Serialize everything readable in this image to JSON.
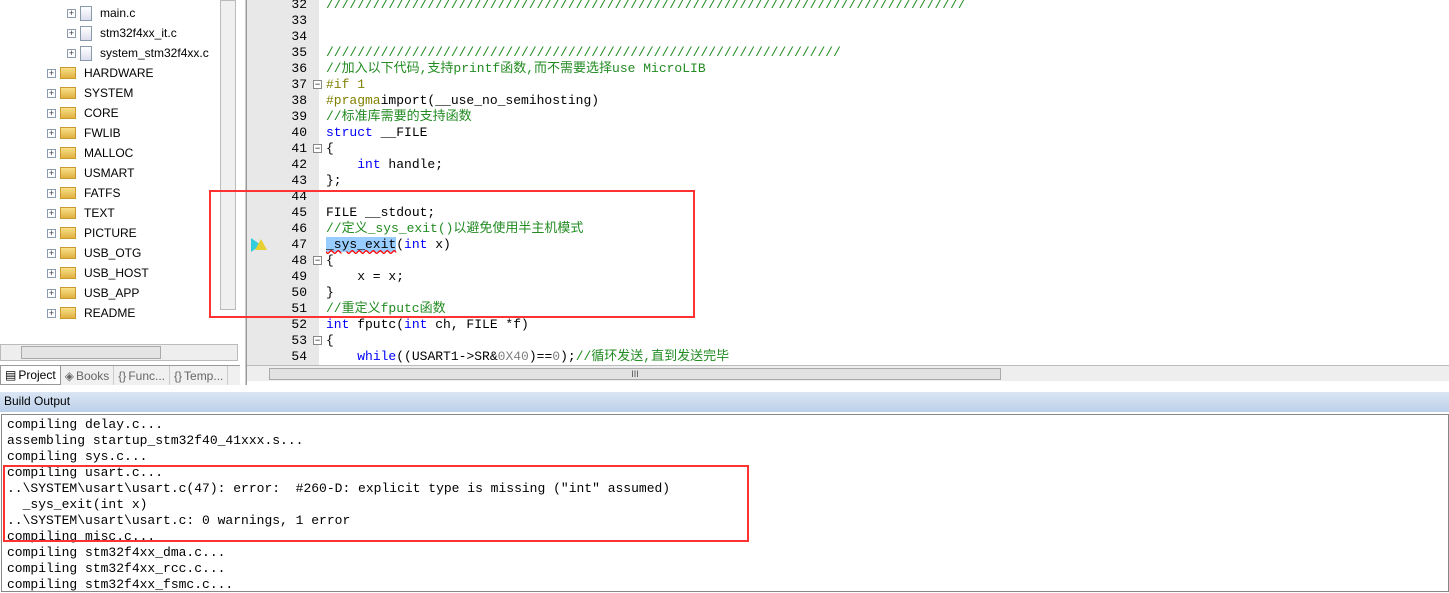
{
  "project_tree": {
    "files": [
      "main.c",
      "stm32f4xx_it.c",
      "system_stm32f4xx.c"
    ],
    "folders": [
      "HARDWARE",
      "SYSTEM",
      "CORE",
      "FWLIB",
      "MALLOC",
      "USMART",
      "FATFS",
      "TEXT",
      "PICTURE",
      "USB_OTG",
      "USB_HOST",
      "USB_APP",
      "README"
    ]
  },
  "panel_tabs": [
    {
      "label": "Project",
      "active": true
    },
    {
      "label": "Books"
    },
    {
      "label": "Func..."
    },
    {
      "label": "Temp..."
    }
  ],
  "editor": {
    "first_line": 32,
    "lines": [
      [
        [
          "c",
          "//////////////////////////////////////////////////////////////////////////////////"
        ]
      ],
      [],
      [],
      [
        [
          "c",
          "//////////////////////////////////////////////////////////////////"
        ]
      ],
      [
        [
          "c",
          "//加入以下代码,支持printf函数,而不需要选择use MicroLIB"
        ]
      ],
      [
        [
          "p",
          "#if 1"
        ]
      ],
      [
        [
          "p",
          "#pragma"
        ],
        [
          "",
          "import(__use_no_semihosting)"
        ]
      ],
      [
        [
          "c",
          "//标准库需要的支持函数"
        ]
      ],
      [
        [
          "k",
          "struct"
        ],
        [
          "",
          " __FILE"
        ]
      ],
      [
        [
          "",
          "{"
        ]
      ],
      [
        [
          "",
          "    "
        ],
        [
          "k",
          "int"
        ],
        [
          "",
          " handle;"
        ]
      ],
      [
        [
          "",
          "};"
        ]
      ],
      [],
      [
        [
          "",
          "FILE __stdout;"
        ]
      ],
      [
        [
          "c",
          "//定义_sys_exit()以避免使用半主机模式"
        ]
      ],
      [
        [
          "hl",
          "_sys_exit"
        ],
        [
          "",
          "("
        ],
        [
          "k",
          "int"
        ],
        [
          "",
          " x)"
        ]
      ],
      [
        [
          "",
          "{"
        ]
      ],
      [
        [
          "",
          "    x = x;"
        ]
      ],
      [
        [
          "",
          "}"
        ]
      ],
      [
        [
          "c",
          "//重定义fputc函数"
        ]
      ],
      [
        [
          "k",
          "int"
        ],
        [
          "",
          " fputc("
        ],
        [
          "k",
          "int"
        ],
        [
          "",
          " ch, FILE *f)"
        ]
      ],
      [
        [
          "",
          "{"
        ]
      ],
      [
        [
          "",
          "    "
        ],
        [
          "k",
          "while"
        ],
        [
          "",
          "((USART1->SR&"
        ],
        [
          "n",
          "0X40"
        ],
        [
          "",
          ")=="
        ],
        [
          "n",
          "0"
        ],
        [
          "",
          ");"
        ],
        [
          "c",
          "//循环发送,直到发送完毕"
        ]
      ]
    ],
    "fold_lines": [
      37,
      41,
      48,
      53
    ],
    "warning_line": 47
  },
  "build_output": {
    "title": "Build Output",
    "lines": [
      "compiling delay.c...",
      "assembling startup_stm32f40_41xxx.s...",
      "compiling sys.c...",
      "compiling usart.c...",
      "..\\SYSTEM\\usart\\usart.c(47): error:  #260-D: explicit type is missing (\"int\" assumed)",
      "  _sys_exit(int x)",
      "..\\SYSTEM\\usart\\usart.c: 0 warnings, 1 error",
      "compiling misc.c...",
      "compiling stm32f4xx_dma.c...",
      "compiling stm32f4xx_rcc.c...",
      "compiling stm32f4xx_fsmc.c..."
    ]
  },
  "colors": {
    "annotation": "#ff3333",
    "comment": "#228B22",
    "keyword": "#0000ff"
  }
}
